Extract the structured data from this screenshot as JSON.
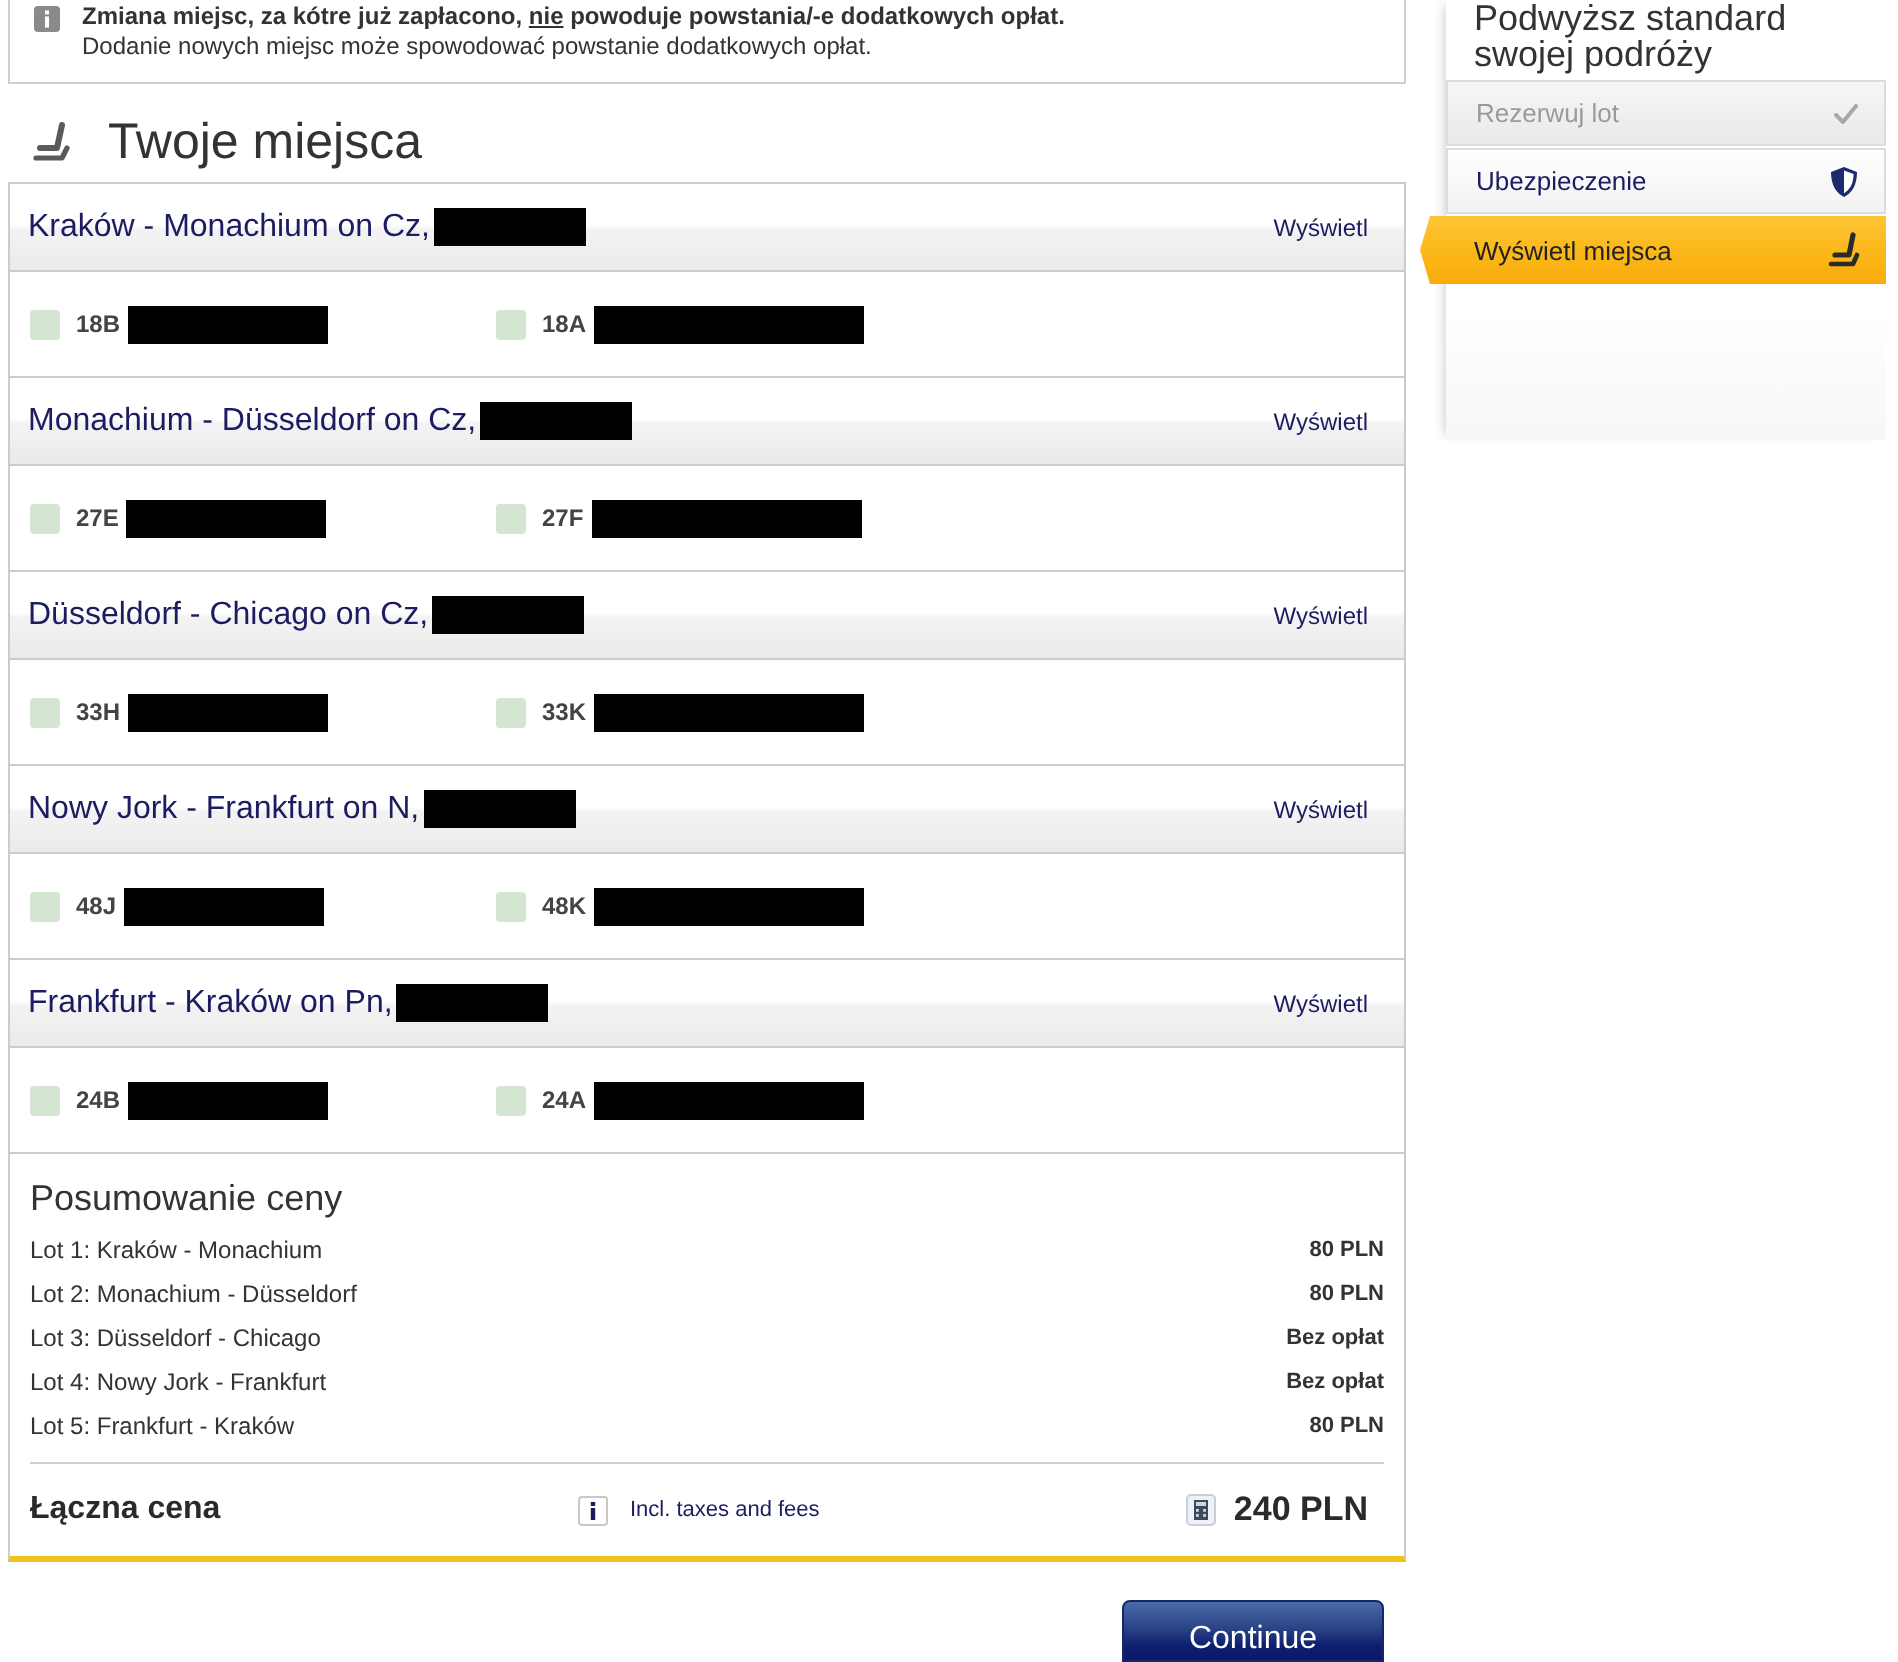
{
  "notice": {
    "parts": [
      {
        "text": "Zmiana miejsc, za kótre już zapłacono, ",
        "underline": false
      },
      {
        "text": "nie",
        "underline": true
      },
      {
        "text": " powoduje powstania/-e dodatkowych opłat.",
        "underline": false
      }
    ],
    "detail": "Dodanie nowych miejsc może spowodować powstanie dodatkowych opłat."
  },
  "heading": "Twoje miejsca",
  "flights": [
    {
      "title": "Kraków - Monachium on Cz,",
      "link": "Wyświetl",
      "seats": [
        "18B",
        "18A"
      ]
    },
    {
      "title": "Monachium - Düsseldorf on Cz,",
      "link": "Wyświetl",
      "seats": [
        "27E",
        "27F"
      ]
    },
    {
      "title": "Düsseldorf - Chicago on Cz,",
      "link": "Wyświetl",
      "seats": [
        "33H",
        "33K"
      ]
    },
    {
      "title": "Nowy Jork - Frankfurt on N,",
      "link": "Wyświetl",
      "seats": [
        "48J",
        "48K"
      ]
    },
    {
      "title": "Frankfurt - Kraków on Pn,",
      "link": "Wyświetl",
      "seats": [
        "24B",
        "24A"
      ]
    }
  ],
  "summary": {
    "title": "Posumowanie ceny",
    "rows": [
      {
        "label": "Lot 1: Kraków - Monachium",
        "price": "80 PLN"
      },
      {
        "label": "Lot 2: Monachium - Düsseldorf",
        "price": "80 PLN"
      },
      {
        "label": "Lot 3: Düsseldorf - Chicago",
        "price": "Bez opłat"
      },
      {
        "label": "Lot 4: Nowy Jork - Frankfurt",
        "price": "Bez opłat"
      },
      {
        "label": "Lot 5: Frankfurt - Kraków",
        "price": "80 PLN"
      }
    ],
    "total": {
      "label": "Łączna cena",
      "note": "Incl. taxes and fees",
      "amount": "240 PLN"
    }
  },
  "continue_button": "Continue",
  "sidebar": {
    "title": "Podwyższ standard swojej podróży",
    "items": [
      {
        "label": "Rezerwuj lot",
        "kind": "booking",
        "selected": false,
        "completed": true
      },
      {
        "label": "Ubezpieczenie",
        "kind": "insurance",
        "selected": false,
        "completed": false
      },
      {
        "label": "Wyświetl miejsca",
        "kind": "seats",
        "selected": true,
        "completed": false
      }
    ]
  }
}
